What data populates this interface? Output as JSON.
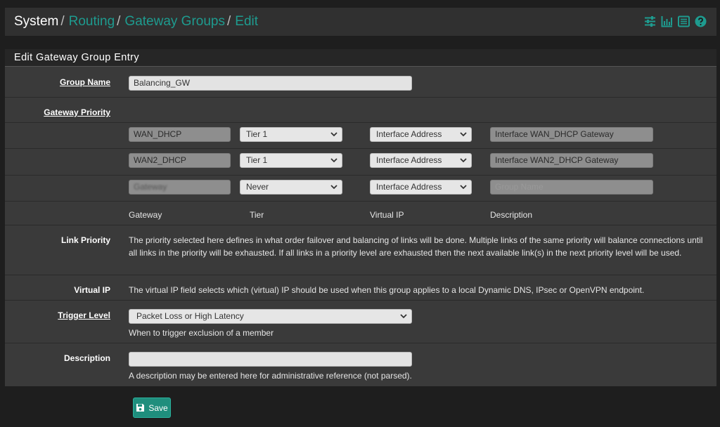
{
  "breadcrumb": {
    "items": [
      "System",
      "Routing",
      "Gateway Groups",
      "Edit"
    ],
    "sep": "/"
  },
  "header_icons": [
    "sliders-icon",
    "chart-icon",
    "list-icon",
    "help-icon"
  ],
  "panel": {
    "title": "Edit Gateway Group Entry"
  },
  "group_name": {
    "label": "Group Name",
    "value": "Balancing_GW"
  },
  "gateway_priority": {
    "label": "Gateway Priority",
    "rows": [
      {
        "gateway": "WAN_DHCP",
        "tier": "Tier 1",
        "vip": "Interface Address",
        "description": "Interface WAN_DHCP Gateway"
      },
      {
        "gateway": "WAN2_DHCP",
        "tier": "Tier 1",
        "vip": "Interface Address",
        "description": "Interface WAN2_DHCP Gateway"
      },
      {
        "gateway": "Gateway",
        "tier": "Never",
        "vip": "Interface Address",
        "description": "Group Name"
      }
    ],
    "columns": [
      "Gateway",
      "Tier",
      "Virtual IP",
      "Description"
    ]
  },
  "link_priority": {
    "label": "Link Priority",
    "text": "The priority selected here defines in what order failover and balancing of links will be done. Multiple links of the same priority will balance connections until all links in the priority will be exhausted. If all links in a priority level are exhausted then the next available link(s) in the next priority level will be used."
  },
  "virtual_ip": {
    "label": "Virtual IP",
    "text": "The virtual IP field selects which (virtual) IP should be used when this group applies to a local Dynamic DNS, IPsec or OpenVPN endpoint."
  },
  "trigger_level": {
    "label": "Trigger Level",
    "value": "Packet Loss or High Latency",
    "help": "When to trigger exclusion of a member"
  },
  "description": {
    "label": "Description",
    "value": "",
    "help": "A description may be entered here for administrative reference (not parsed)."
  },
  "save": {
    "label": "Save"
  },
  "colors": {
    "accent": "#1e9b8f",
    "button": "#1f8e7d",
    "panel": "#3a3a3a",
    "bg": "#1e1e1e"
  }
}
